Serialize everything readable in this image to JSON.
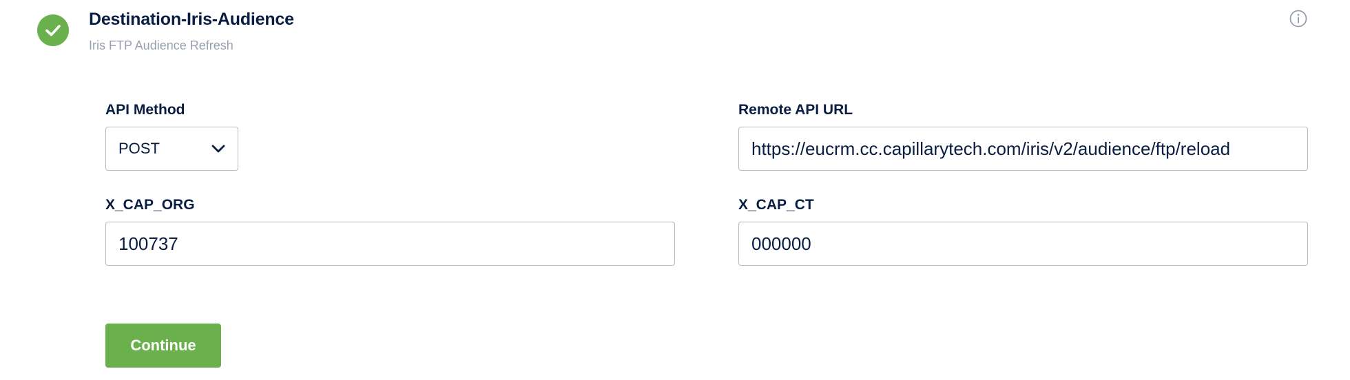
{
  "step": {
    "title": "Destination-Iris-Audience",
    "subtitle": "Iris FTP Audience Refresh",
    "status_icon": "check-circle-icon",
    "status_color": "#6ab04c",
    "info_icon": "info-icon"
  },
  "form": {
    "api_method": {
      "label": "API Method",
      "value": "POST",
      "icon": "chevron-down-icon"
    },
    "remote_api_url": {
      "label": "Remote API URL",
      "value": "https://eucrm.cc.capillarytech.com/iris/v2/audience/ftp/reload"
    },
    "x_cap_org": {
      "label": "X_CAP_ORG",
      "value": "100737"
    },
    "x_cap_ct": {
      "label": "X_CAP_CT",
      "value": "000000"
    }
  },
  "actions": {
    "continue_label": "Continue",
    "continue_color": "#6ab04c"
  }
}
